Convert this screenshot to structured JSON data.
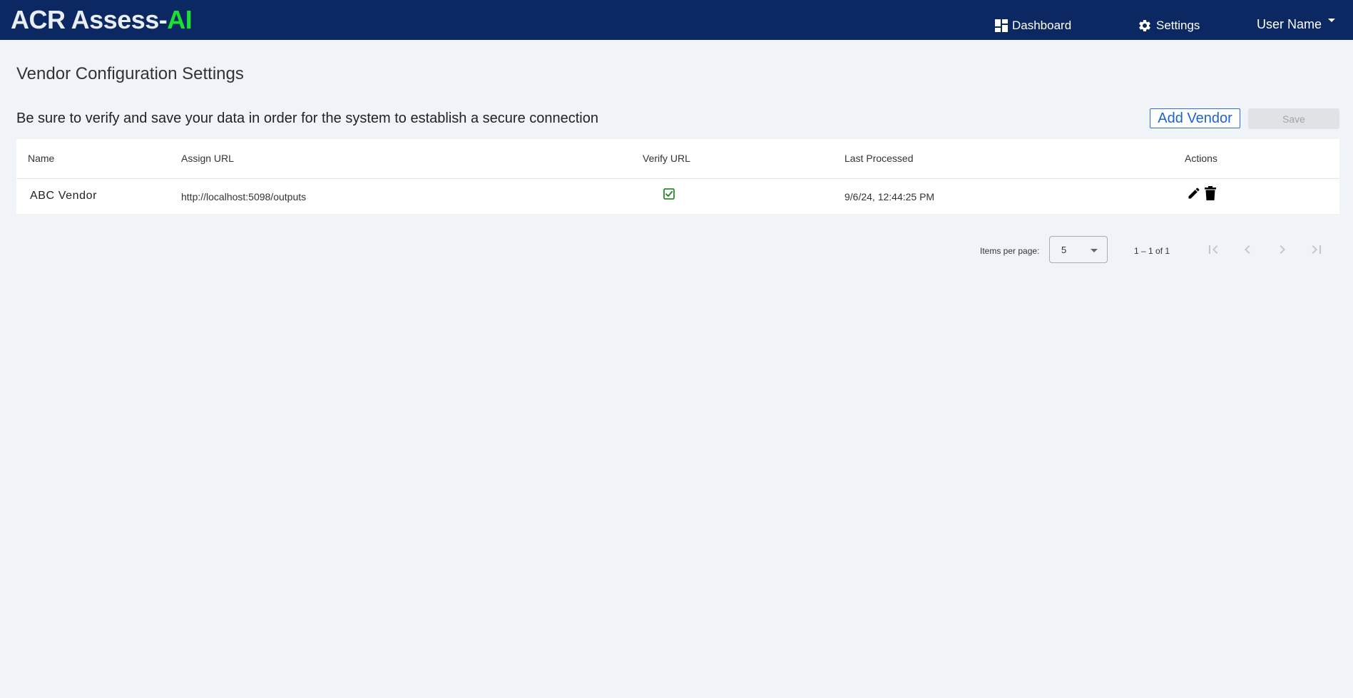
{
  "navbar": {
    "brand_main": "ACR Assess-",
    "brand_accent": "AI",
    "dashboard_label": "Dashboard",
    "settings_label": "Settings",
    "user_label": "User Name"
  },
  "page": {
    "title": "Vendor Configuration Settings",
    "notice": "Be sure to verify and save your data in order for the system to establish a secure connection",
    "add_vendor_label": "Add Vendor",
    "save_label": "Save"
  },
  "table": {
    "columns": [
      "Name",
      "Assign URL",
      "Verify URL",
      "Last Processed",
      "Actions"
    ],
    "rows": [
      {
        "name": "ABC Vendor",
        "assign_url": "http://localhost:5098/outputs",
        "verified": true,
        "last_processed": "9/6/24, 12:44:25 PM"
      }
    ]
  },
  "paginator": {
    "items_per_page_label": "Items per page:",
    "page_size": "5",
    "range_label": "1 – 1 of 1"
  },
  "colors": {
    "navbar": "#0c2863",
    "brand_accent": "#19e232",
    "link_blue": "#1f63c9",
    "check_green": "#2e8b2e",
    "background": "#f0f4f9"
  },
  "icons": {
    "dashboard": "dashboard-icon",
    "settings": "gear-icon",
    "user_dropdown": "caret-down-icon",
    "verify": "checkbox-checked-icon",
    "edit": "pencil-icon",
    "delete": "trash-icon",
    "first_page": "first-page-icon",
    "prev_page": "chevron-left-icon",
    "next_page": "chevron-right-icon",
    "last_page": "last-page-icon"
  }
}
